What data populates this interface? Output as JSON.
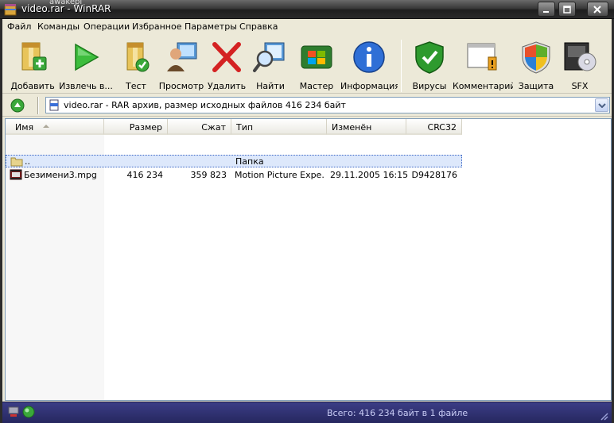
{
  "window": {
    "title": "video.rar - WinRAR",
    "overlay_user": "awakepl",
    "colors": {
      "titlebar": "#2a2a2a",
      "body": "#ece9d8",
      "status": "#2e306f"
    }
  },
  "menu": [
    "Файл",
    "Команды",
    "Операции",
    "Избранное",
    "Параметры",
    "Справка"
  ],
  "toolbar": [
    {
      "label": "Добавить",
      "icon": "add-archive-icon"
    },
    {
      "label": "Извлечь в...",
      "icon": "extract-arrow-icon"
    },
    {
      "label": "Тест",
      "icon": "test-folder-icon"
    },
    {
      "label": "Просмотр",
      "icon": "view-icon"
    },
    {
      "label": "Удалить",
      "icon": "delete-x-icon"
    },
    {
      "label": "Найти",
      "icon": "find-magnifier-icon"
    },
    {
      "label": "Мастер",
      "icon": "wizard-icon"
    },
    {
      "label": "Информация",
      "icon": "info-icon"
    },
    {
      "label": "Вирусы",
      "icon": "virus-shield-icon"
    },
    {
      "label": "Комментарий",
      "icon": "comment-icon"
    },
    {
      "label": "Защита",
      "icon": "protect-shield-icon"
    },
    {
      "label": "SFX",
      "icon": "sfx-icon"
    }
  ],
  "address": {
    "text": "video.rar - RAR архив, размер исходных файлов 416 234 байт"
  },
  "columns": [
    "Имя",
    "Размер",
    "Сжат",
    "Тип",
    "Изменён",
    "CRC32"
  ],
  "rows": [
    {
      "name": "..",
      "size": "",
      "packed": "",
      "type": "Папка",
      "modified": "",
      "crc": "",
      "icon": "parent-folder-icon",
      "selected": true
    },
    {
      "name": "Безимени3.mpg",
      "size": "416 234",
      "packed": "359 823",
      "type": "Motion Picture Expe...",
      "modified": "29.11.2005 16:15",
      "crc": "D9428176",
      "icon": "mpg-file-icon",
      "selected": false
    }
  ],
  "status": {
    "text": "Всего: 416 234 байт в 1 файле"
  }
}
